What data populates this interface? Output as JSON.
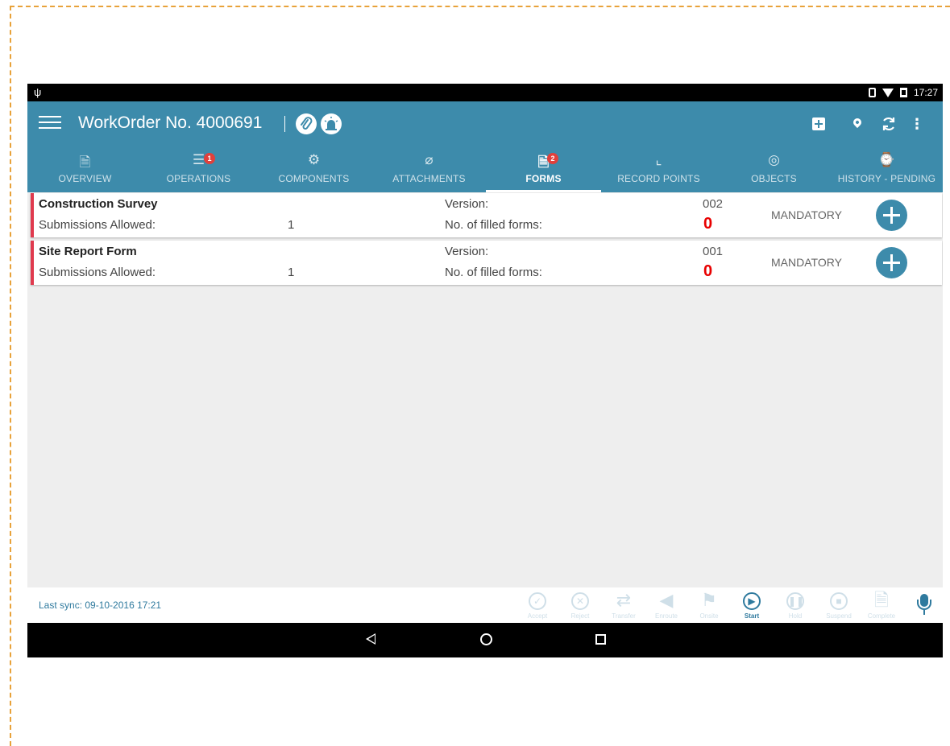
{
  "statusbar": {
    "time": "17:27",
    "usb_icon": "usb-icon"
  },
  "appbar": {
    "title": "WorkOrder No. 4000691",
    "icons": [
      "hamburger-menu-icon",
      "attachment-clip-icon",
      "emergency-siren-icon",
      "add-box-icon",
      "location-pin-icon",
      "sync-icon",
      "more-vert-icon"
    ]
  },
  "tabs": [
    {
      "label": "OVERVIEW",
      "icon": "overview-doc-icon",
      "badge": ""
    },
    {
      "label": "OPERATIONS",
      "icon": "operations-sliders-icon",
      "badge": "1"
    },
    {
      "label": "COMPONENTS",
      "icon": "components-gears-icon",
      "badge": ""
    },
    {
      "label": "ATTACHMENTS",
      "icon": "paperclip-icon",
      "badge": ""
    },
    {
      "label": "FORMS",
      "icon": "forms-doc-icon",
      "badge": "2"
    },
    {
      "label": "RECORD POINTS",
      "icon": "record-points-chart-icon",
      "badge": ""
    },
    {
      "label": "OBJECTS",
      "icon": "objects-target-icon",
      "badge": ""
    },
    {
      "label": "HISTORY - PENDING",
      "icon": "history-pending-icon",
      "badge": ""
    }
  ],
  "active_tab": "FORMS",
  "forms": [
    {
      "title": "Construction Survey",
      "submissions_label": "Submissions Allowed:",
      "submissions_value": "1",
      "version_label": "Version:",
      "version_value": "002",
      "filled_label": "No. of filled forms:",
      "filled_value": "0",
      "status": "MANDATORY"
    },
    {
      "title": "Site Report Form",
      "submissions_label": "Submissions Allowed:",
      "submissions_value": "1",
      "version_label": "Version:",
      "version_value": "001",
      "filled_label": "No. of filled forms:",
      "filled_value": "0",
      "status": "MANDATORY"
    }
  ],
  "footer": {
    "last_sync": "Last sync: 09-10-2016 17:21",
    "actions": [
      {
        "label": "Accept",
        "icon": "check-circle-icon",
        "enabled": false
      },
      {
        "label": "Reject",
        "icon": "x-circle-icon",
        "enabled": false
      },
      {
        "label": "Transfer",
        "icon": "transfer-arrows-icon",
        "enabled": false
      },
      {
        "label": "Enroute",
        "icon": "navigation-arrow-icon",
        "enabled": false
      },
      {
        "label": "Onsite",
        "icon": "flag-icon",
        "enabled": false
      },
      {
        "label": "Start",
        "icon": "play-circle-icon",
        "enabled": true
      },
      {
        "label": "Hold",
        "icon": "pause-circle-icon",
        "enabled": false
      },
      {
        "label": "Suspend",
        "icon": "stop-circle-icon",
        "enabled": false
      },
      {
        "label": "Complete",
        "icon": "complete-doc-icon",
        "enabled": false
      }
    ]
  },
  "colors": {
    "primary": "#3d8bab",
    "accent_red": "#e03a4e",
    "count_red": "#e80000",
    "start_blue": "#2f7a9e"
  }
}
